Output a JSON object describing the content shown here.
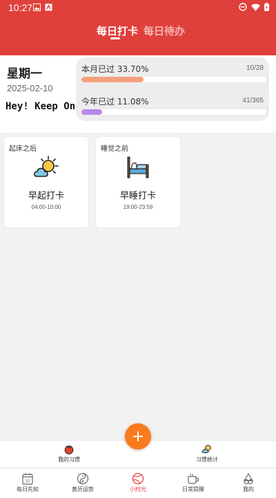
{
  "status": {
    "time": "10:27"
  },
  "tabs": [
    {
      "label": "每日打卡",
      "active": true
    },
    {
      "label": "每日待办",
      "active": false
    }
  ],
  "today": {
    "weekday": "星期一",
    "date": "2025-02-10",
    "motto": "Hey! Keep On"
  },
  "progress": {
    "month": {
      "label": "本月已过 33.70%",
      "count": "10/28",
      "fraction": 0.337,
      "color": "#f5a07c"
    },
    "year": {
      "label": "今年已过 11.08%",
      "count": "41/365",
      "fraction": 0.1108,
      "color": "#b48ae8"
    }
  },
  "cards": [
    {
      "tag": "起床之后",
      "title": "早起打卡",
      "time": "04:00-10:00",
      "icon": "sun-cloud-icon"
    },
    {
      "tag": "睡觉之前",
      "title": "早睡打卡",
      "time": "19:00-23:59",
      "icon": "bed-icon"
    }
  ],
  "subbar": [
    {
      "label": "我的习惯",
      "icon": "tomato-icon"
    },
    {
      "label": "习惯统计",
      "icon": "sun-cloud-small-icon"
    }
  ],
  "fab": {
    "icon": "plus-icon"
  },
  "nav": [
    {
      "label": "每日先知",
      "icon": "calendar-icon",
      "active": false
    },
    {
      "label": "黄历运势",
      "icon": "yinyang-icon",
      "active": false
    },
    {
      "label": "小时光",
      "icon": "ball-icon",
      "active": true
    },
    {
      "label": "日常提醒",
      "icon": "cup-icon",
      "active": false
    },
    {
      "label": "我的",
      "icon": "profile-icon",
      "active": false
    }
  ],
  "colors": {
    "primary": "#e0403b",
    "fab": "#fb7a1e"
  }
}
